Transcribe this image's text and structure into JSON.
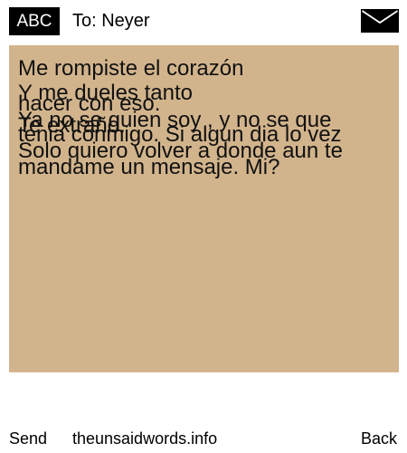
{
  "header": {
    "badge_label": "ABC",
    "to_label": "To: Neyer",
    "envelope_icon": "envelope-icon"
  },
  "message": {
    "background_color": "#d2b48c",
    "lines": [
      "Me rompiste el corazón",
      "Y me dueles tanto",
      "hacer con eso.",
      "Ya no se quien soy , y no se que",
      "Te extraño.",
      "tenia conmigo. Si algun dia lo vez",
      "Solo quiero volver a donde aun te",
      "mandame un mensaje. Mi?"
    ]
  },
  "footer": {
    "send_label": "Send",
    "site_label": "theunsaidwords.info",
    "back_label": "Back"
  }
}
